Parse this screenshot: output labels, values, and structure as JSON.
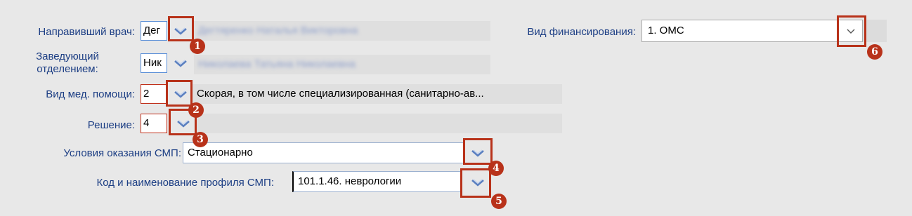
{
  "form": {
    "referring_doctor": {
      "label": "Направивший врач:",
      "code": "Дег",
      "name": "Дегтяренко Наталья Викторовна"
    },
    "head_of_department": {
      "label_line1": "Заведующий",
      "label_line2": "отделением:",
      "code": "Ник",
      "name": "Николаева Татьяна Николаевна"
    },
    "care_type": {
      "label": "Вид мед. помощи:",
      "code": "2",
      "name": "Скорая, в том числе специализированная (санитарно-ав..."
    },
    "decision": {
      "label": "Решение:",
      "code": "4",
      "name": ""
    },
    "conditions": {
      "label": "Условия оказания СМП:",
      "value": "Стационарно"
    },
    "profile": {
      "label": "Код и наименование профиля СМП:",
      "value": "101.1.46. неврологии"
    },
    "financing": {
      "label": "Вид финансирования:",
      "value": "1. ОМС"
    }
  },
  "annotations": [
    "1",
    "2",
    "3",
    "4",
    "5",
    "6"
  ],
  "colors": {
    "label": "#1c3e84",
    "annotation": "#b8321a",
    "field_border": "#5a8fd8",
    "background": "#e8e8e8"
  },
  "icons": {
    "lookup": "chevron-down-icon",
    "dropdown": "chevron-down-icon"
  }
}
